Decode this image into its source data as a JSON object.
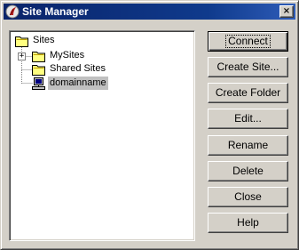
{
  "window": {
    "title": "Site Manager",
    "close_glyph": "×"
  },
  "tree": {
    "nodes": [
      {
        "label": "Sites",
        "icon": "folder-icon"
      },
      {
        "label": "MySites",
        "icon": "folder-icon",
        "expander": "+"
      },
      {
        "label": "Shared Sites",
        "icon": "folder-icon"
      },
      {
        "label": "domainname",
        "icon": "computer-icon",
        "selected": true
      }
    ]
  },
  "buttons": {
    "connect": "Connect",
    "create_site": "Create Site...",
    "create_folder": "Create Folder",
    "edit": "Edit...",
    "rename": "Rename",
    "delete": "Delete",
    "close": "Close",
    "help": "Help"
  },
  "colors": {
    "title_bar_start": "#0a246a",
    "title_bar_end": "#2e5cb8",
    "face": "#d4d0c8",
    "tree_background": "#ffffff",
    "selection": "#c0c0c0"
  }
}
